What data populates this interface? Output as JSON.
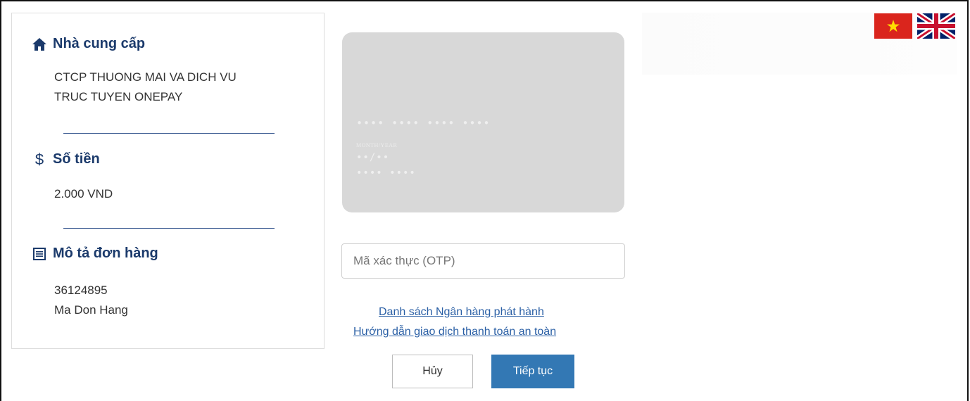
{
  "merchant": {
    "title": "Nhà cung cấp",
    "name_line1": "CTCP THUONG MAI VA DICH VU",
    "name_line2": "TRUC TUYEN ONEPAY"
  },
  "amount": {
    "title": "Số tiền",
    "value": "2.000 VND"
  },
  "order": {
    "title": "Mô tả đơn hàng",
    "id": "36124895",
    "description": "Ma Don Hang"
  },
  "card": {
    "number_mask": "•••• •••• •••• ••••",
    "expiry_label": "MONTH/YEAR",
    "expiry_mask": "••/••",
    "name_mask": "•••• ••••"
  },
  "otp": {
    "placeholder": "Mã xác thực (OTP)"
  },
  "links": {
    "issuer_banks": "Danh sách Ngân hàng phát hành",
    "safe_guide": "Hướng dẫn giao dịch thanh toán an toàn"
  },
  "buttons": {
    "cancel": "Hủy",
    "continue": "Tiếp tục"
  },
  "languages": {
    "vietnamese_icon": "vietnam-flag-icon",
    "english_icon": "uk-flag-icon"
  },
  "colors": {
    "heading": "#1b3a6b",
    "primary_button": "#3378b4",
    "link": "#2a5fa5"
  }
}
